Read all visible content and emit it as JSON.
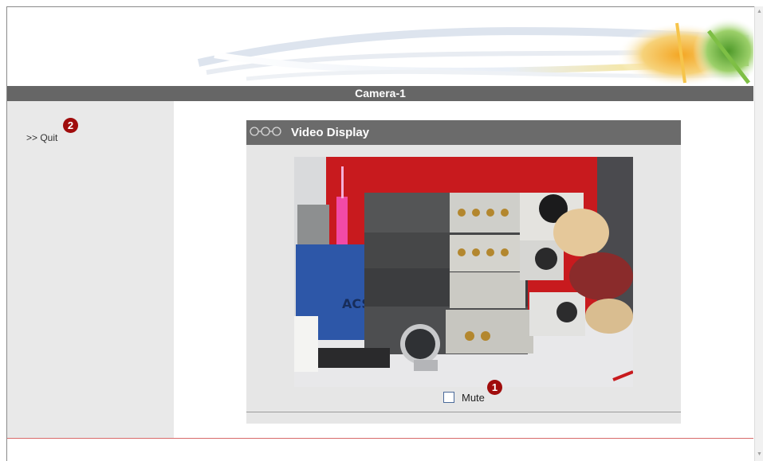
{
  "header": {
    "title": "Camera-1"
  },
  "sidebar": {
    "quit_label": ">> Quit",
    "quit_badge": "2"
  },
  "panel": {
    "title": "Video Display"
  },
  "video": {
    "mute_label": "Mute",
    "mute_checked": false,
    "mute_badge": "1"
  },
  "colors": {
    "title_bar": "#666666",
    "panel_header": "#6b6b6b",
    "badge": "#a00c0c",
    "footer_rule": "#d86a6a"
  }
}
